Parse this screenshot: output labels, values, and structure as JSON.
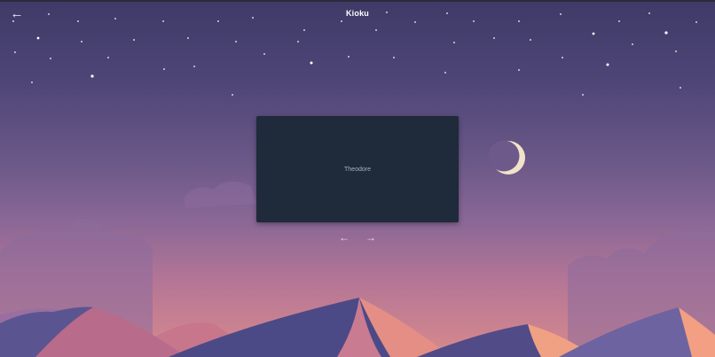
{
  "header": {
    "title": "Kioku",
    "back_icon": "←",
    "back_icon_name": "arrow-left-icon"
  },
  "card": {
    "text": "Theodore"
  },
  "navigation": {
    "prev_icon": "←",
    "next_icon": "→"
  },
  "colors": {
    "sky_top": "#3f3a67",
    "sky_bottom": "#d88a8c",
    "card_background": "#1f2a3a",
    "moon": "#f1e2c6",
    "dune_shadow": "#4c4a86",
    "dune_light": "#ef9a80"
  }
}
